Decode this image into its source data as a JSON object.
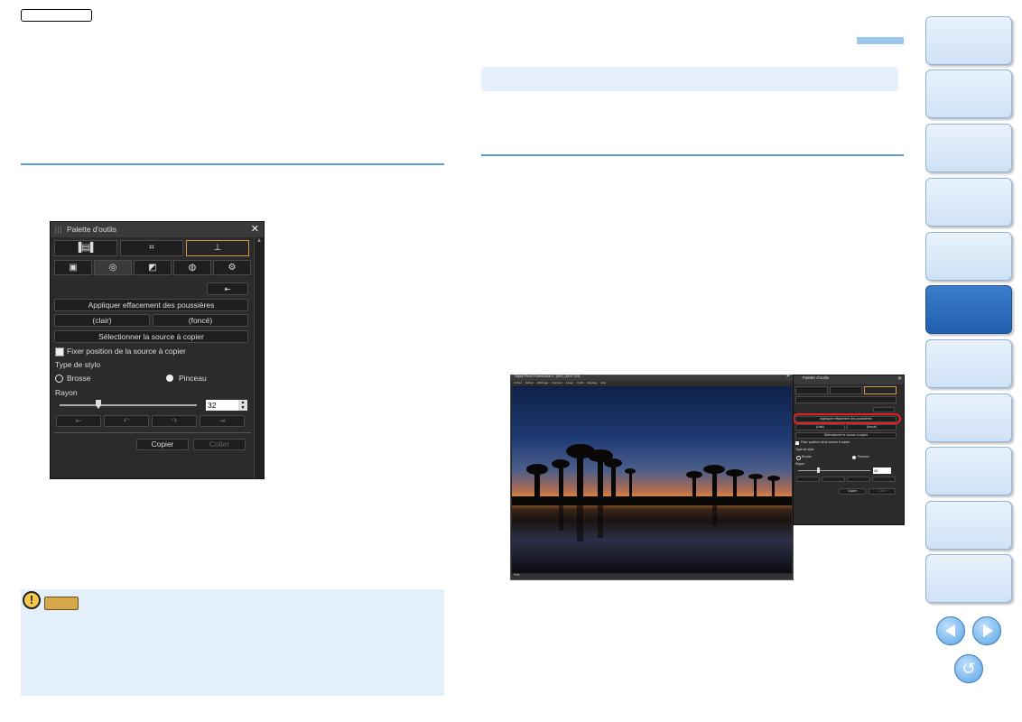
{
  "doc": {
    "blank_button_label": "",
    "note_badge_label": ""
  },
  "palette": {
    "title": "Palette d'outils",
    "tabs_top": [
      "▐▤▌",
      "⌗",
      "⊥"
    ],
    "tabs_second": [
      "▣",
      "◎",
      "◩",
      "◍",
      "⚙"
    ],
    "apply_dust": "Appliquer effacement des poussières",
    "light": "(clair)",
    "dark": "(foncé)",
    "select_source": "Sélectionner la source à copier",
    "fix_position": "Fixer position de la source à copier",
    "style_type": "Type de stylo",
    "brush": "Brosse",
    "pen": "Pinceau",
    "radius_label": "Rayon",
    "radius_value": "32",
    "copy": "Copier",
    "paste": "Coller"
  },
  "small_palette": {
    "title": "Palette d'outils",
    "apply_dust": "Appliquer effacement des poussières",
    "light": "(clair)",
    "dark": "(foncé)",
    "select_source": "Sélectionner la source à copier",
    "fix_position": "Fixer position de la source à copier",
    "style_type": "Type de stylo",
    "brush": "Brosse",
    "pen": "Pinceau",
    "radius_label": "Rayon",
    "radius_value": "32",
    "copy": "Copier",
    "paste": "Coller"
  },
  "app_window": {
    "title": "Digital Photo Professional 4 - [IMG_0001.CR2]",
    "menu": [
      "Fichier",
      "Édition",
      "Affichage",
      "Imprimer",
      "Image",
      "Outils",
      "Réglage",
      "Aide"
    ],
    "status": "Prêt"
  },
  "nav": {
    "prev_icon": "arrow-left-icon",
    "next_icon": "arrow-right-icon",
    "home_icon": "return-icon"
  },
  "colors": {
    "accent_blue": "#5b9bd5",
    "note_bg": "#e3effa",
    "active_tab": "#1f5fae"
  }
}
